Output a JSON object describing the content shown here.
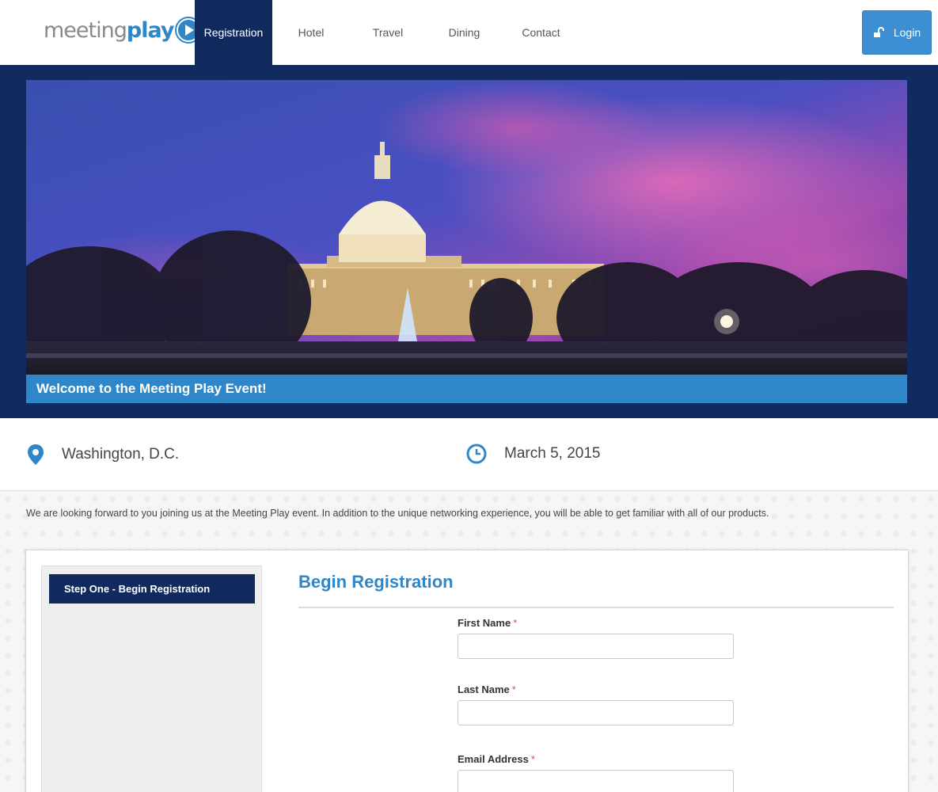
{
  "brand": {
    "logo_part1": "meeting",
    "logo_part2": "play",
    "primary": "#2f86c8",
    "navy": "#102a5e"
  },
  "nav": {
    "items": [
      {
        "label": "Registration",
        "active": true
      },
      {
        "label": "Hotel",
        "active": false
      },
      {
        "label": "Travel",
        "active": false
      },
      {
        "label": "Dining",
        "active": false
      },
      {
        "label": "Contact",
        "active": false
      }
    ],
    "login_label": "Login",
    "login_icon": "unlock-icon"
  },
  "banner": {
    "image": "illustration of the U.S. Capitol at dusk with pink and blue sky",
    "welcome": "Welcome to the Meeting Play Event!"
  },
  "event": {
    "location": "Washington, D.C.",
    "location_icon": "map-pin-icon",
    "date": "March 5, 2015",
    "date_icon": "clock-icon"
  },
  "intro": "We are looking forward to you joining us at the Meeting Play event.  In addition to the unique networking experience, you will be able to get familiar with all of our products.",
  "steps": {
    "active": "Step One - Begin Registration"
  },
  "form": {
    "title": "Begin Registration",
    "fields": [
      {
        "label": "First Name",
        "required_mark": "*",
        "value": ""
      },
      {
        "label": "Last Name",
        "required_mark": "*",
        "value": ""
      },
      {
        "label": "Email Address",
        "required_mark": "*",
        "value": ""
      }
    ]
  }
}
